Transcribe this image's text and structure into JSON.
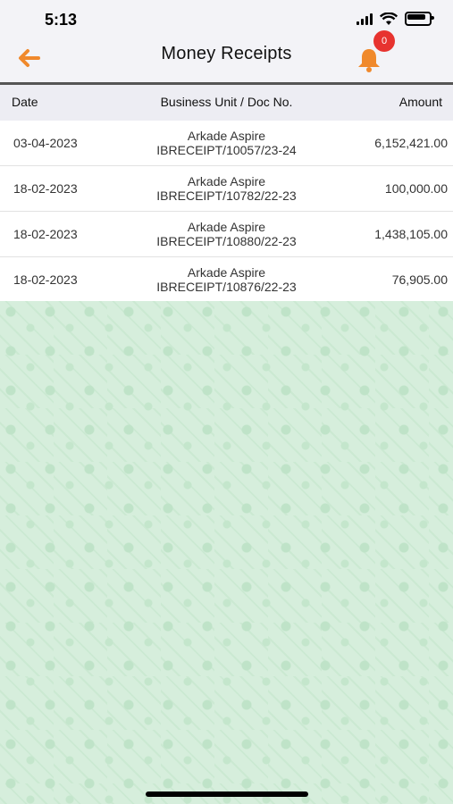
{
  "status_bar": {
    "time": "5:13"
  },
  "header": {
    "title": "Money Receipts",
    "notification_count": "0"
  },
  "table": {
    "headers": {
      "date": "Date",
      "unit": "Business Unit / Doc No.",
      "amount": "Amount"
    },
    "rows": [
      {
        "date": "03-04-2023",
        "unit": "Arkade Aspire",
        "doc": "IBRECEIPT/10057/23-24",
        "amount": "6,152,421.00"
      },
      {
        "date": "18-02-2023",
        "unit": "Arkade Aspire",
        "doc": "IBRECEIPT/10782/22-23",
        "amount": "100,000.00"
      },
      {
        "date": "18-02-2023",
        "unit": "Arkade Aspire",
        "doc": "IBRECEIPT/10880/22-23",
        "amount": "1,438,105.00"
      },
      {
        "date": "18-02-2023",
        "unit": "Arkade Aspire",
        "doc": "IBRECEIPT/10876/22-23",
        "amount": "76,905.00"
      }
    ]
  },
  "colors": {
    "accent": "#f0892c",
    "badge": "#e7332f",
    "background_pattern": "#d6eedc"
  }
}
